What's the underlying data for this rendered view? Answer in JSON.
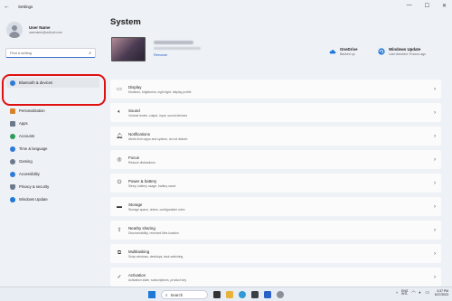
{
  "window": {
    "title": "Settings"
  },
  "profile": {
    "name": "User Name",
    "email": "username@outlook.com"
  },
  "search": {
    "placeholder": "Find a setting"
  },
  "sidebar": {
    "items": [
      {
        "label": "Bluetooth & devices",
        "icon": "bluetooth-icon",
        "color": "#2f7ad6",
        "selected": true
      },
      {
        "label": "Personalization",
        "icon": "brush-icon",
        "color": "#d9822b"
      },
      {
        "label": "Apps",
        "icon": "apps-icon",
        "color": "#6c7a8c"
      },
      {
        "label": "Accounts",
        "icon": "person-icon",
        "color": "#2e9b5d"
      },
      {
        "label": "Time & language",
        "icon": "globe-clock-icon",
        "color": "#2f7ad6"
      },
      {
        "label": "Gaming",
        "icon": "controller-icon",
        "color": "#6c7a8c"
      },
      {
        "label": "Accessibility",
        "icon": "accessibility-icon",
        "color": "#2f7ad6"
      },
      {
        "label": "Privacy & security",
        "icon": "shield-icon",
        "color": "#6c7a8c"
      },
      {
        "label": "Windows Update",
        "icon": "update-icon",
        "color": "#1e78d7"
      }
    ]
  },
  "main": {
    "title": "System",
    "device": {
      "rename": "Rename"
    },
    "onedrive": {
      "title": "OneDrive",
      "subtitle": "Backed up",
      "icon": "cloud-icon",
      "color": "#1e78d7"
    },
    "update": {
      "title": "Windows Update",
      "subtitle": "Last checked: 5 hours ago",
      "icon": "update-icon",
      "color": "#1e78d7"
    },
    "cards": [
      {
        "title": "Display",
        "subtitle": "Monitors, brightness, night light, display profile",
        "icon": "display-icon"
      },
      {
        "title": "Sound",
        "subtitle": "Volume levels, output, input, sound devices",
        "icon": "speaker-icon"
      },
      {
        "title": "Notifications",
        "subtitle": "Alerts from apps and system, do not disturb",
        "icon": "bell-icon"
      },
      {
        "title": "Focus",
        "subtitle": "Reduce distractions",
        "icon": "focus-icon"
      },
      {
        "title": "Power & battery",
        "subtitle": "Sleep, battery usage, battery saver",
        "icon": "power-icon"
      },
      {
        "title": "Storage",
        "subtitle": "Storage space, drives, configuration rules",
        "icon": "storage-icon"
      },
      {
        "title": "Nearby sharing",
        "subtitle": "Discoverability, received files location",
        "icon": "share-icon"
      },
      {
        "title": "Multitasking",
        "subtitle": "Snap windows, desktops, task switching",
        "icon": "multitask-icon"
      },
      {
        "title": "Activation",
        "subtitle": "Activation state, subscriptions, product key",
        "icon": "activation-icon"
      }
    ]
  },
  "taskbar": {
    "search_label": "Search",
    "lang_line1": "ENG",
    "lang_line2": "INTL",
    "time": "4:37 PM",
    "date": "6/27/2023"
  }
}
